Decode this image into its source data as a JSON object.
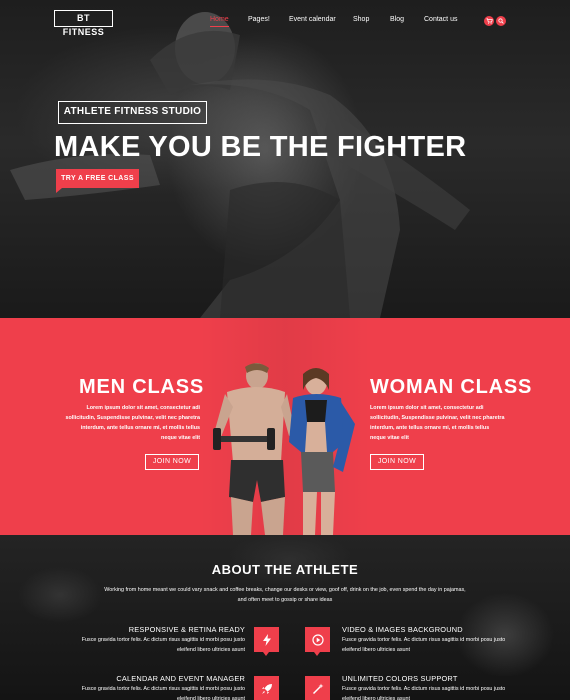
{
  "brand": {
    "logo_text": "BT FITNESS"
  },
  "nav": {
    "items": [
      {
        "label": "Home",
        "active": true
      },
      {
        "label": "Pages!",
        "active": false
      },
      {
        "label": "Event calendar",
        "active": false
      },
      {
        "label": "Shop",
        "active": false
      },
      {
        "label": "Blog",
        "active": false
      },
      {
        "label": "Contact us",
        "active": false
      }
    ],
    "icons": [
      "cart-icon",
      "search-icon"
    ]
  },
  "hero": {
    "tag": "ATHLETE FITNESS STUDIO",
    "title": "MAKE YOU BE THE FIGHTER",
    "cta": "TRY A FREE CLASS"
  },
  "classes": {
    "men": {
      "title": "MEN CLASS",
      "text": "Lorem ipsum dolor sit amet, consectetur adi sollicitudin, Suspendisse pulvinar, velit nec pharetra interdum, ante tellus ornare mi, et mollis tellus neque vitae elit",
      "button": "JOIN NOW"
    },
    "women": {
      "title": "WOMAN CLASS",
      "text": "Lorem ipsum dolor sit amet, consectetur adi sollicitudin, Suspendisse pulvinar, velit nec pharetra interdum, ante tellus ornare mi, et mollis tellus neque vitae elit",
      "button": "JOIN NOW"
    }
  },
  "about": {
    "title": "ABOUT THE ATHLETE",
    "subtitle": "Working from home meant we could vary snack and coffee breaks, change our desks or view, goof off, drink on the job, even spend the day in pajamas, and often meet to gossip or share ideas",
    "features": [
      {
        "title": "RESPONSIVE & RETINA READY",
        "text": "Fusce gravida tortor felis. Ac dictum risus sagittis id morbi posu justo eleifend libero ultricies asunt",
        "icon": "lightning-icon"
      },
      {
        "title": "VIDEO & IMAGES BACKGROUND",
        "text": "Fusce gravida tortor felis. Ac dictum risus sagittis id morbi posu justo eleifend libero ultricies asunt",
        "icon": "play-icon"
      },
      {
        "title": "CALENDAR AND EVENT MANAGER",
        "text": "Fusce gravida tortor felis. Ac dictum risus sagittis id morbi posu justo eleifend libero ultricies asunt",
        "icon": "rocket-icon"
      },
      {
        "title": "UNLIMITED COLORS SUPPORT",
        "text": "Fusce gravida tortor felis. Ac dictum risus sagittis id morbi posu justo eleifend libero ultricies asunt",
        "icon": "magic-wand-icon"
      }
    ]
  },
  "colors": {
    "accent": "#ef3f4b",
    "dark": "#1b1b1b"
  }
}
